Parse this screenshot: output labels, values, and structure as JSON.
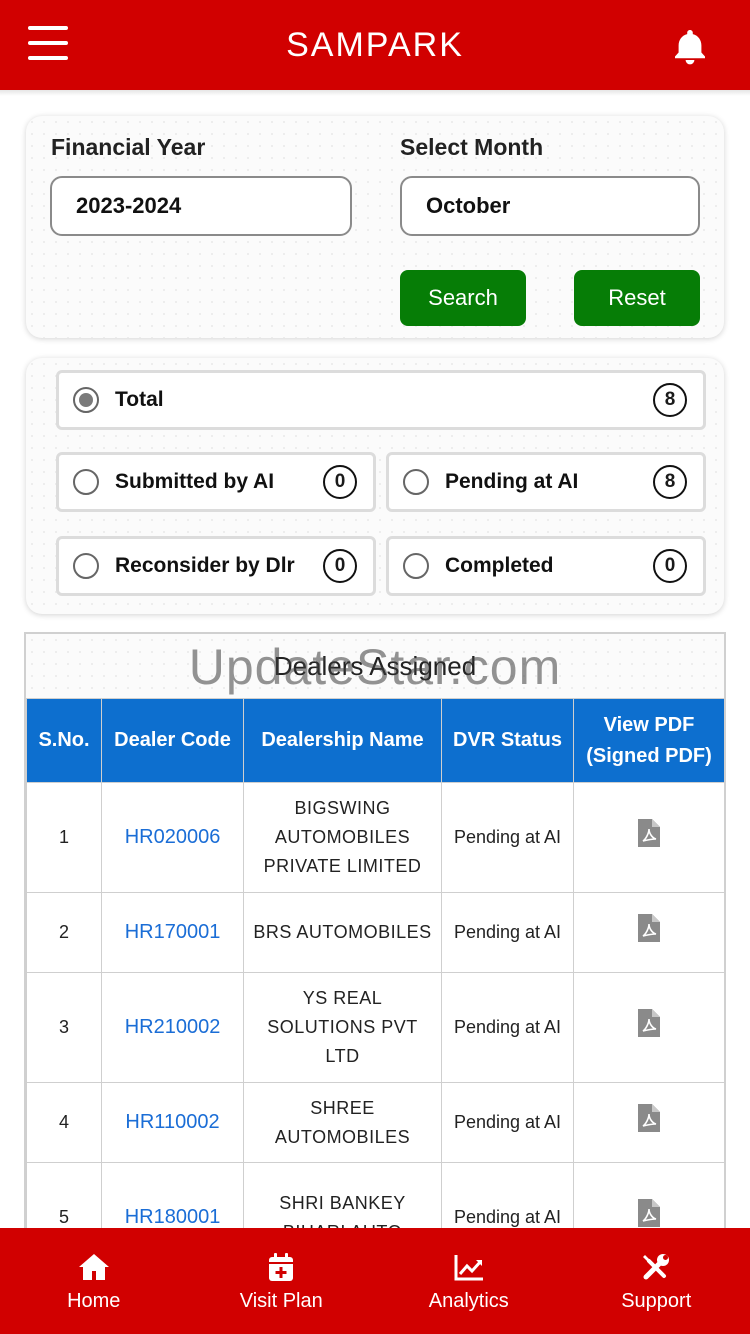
{
  "header": {
    "title": "SAMPARK"
  },
  "filters": {
    "financial_year_label": "Financial Year",
    "financial_year_value": "2023-2024",
    "month_label": "Select Month",
    "month_value": "October",
    "search_label": "Search",
    "reset_label": "Reset"
  },
  "status": {
    "total": {
      "label": "Total",
      "count": "8",
      "selected": true
    },
    "submitted": {
      "label": "Submitted by AI",
      "count": "0"
    },
    "pending": {
      "label": "Pending at AI",
      "count": "8"
    },
    "reconsider": {
      "label": "Reconsider by Dlr",
      "count": "0"
    },
    "completed": {
      "label": "Completed",
      "count": "0"
    }
  },
  "table": {
    "title": "Dealers Assigned",
    "watermark": "UpdateStar.com",
    "headers": {
      "sno": "S.No.",
      "code": "Dealer Code",
      "name": "Dealership Name",
      "status": "DVR Status",
      "pdf_line1": "View PDF",
      "pdf_line2": "(Signed PDF)"
    },
    "rows": [
      {
        "sno": "1",
        "code": "HR020006",
        "name": "BIGSWING AUTOMOBILES PRIVATE LIMITED",
        "status": "Pending at AI"
      },
      {
        "sno": "2",
        "code": "HR170001",
        "name": "BRS AUTOMOBILES",
        "status": "Pending at AI"
      },
      {
        "sno": "3",
        "code": "HR210002",
        "name": "YS REAL SOLUTIONS PVT LTD",
        "status": "Pending at AI"
      },
      {
        "sno": "4",
        "code": "HR110002",
        "name": "SHREE AUTOMOBILES",
        "status": "Pending at AI"
      },
      {
        "sno": "5",
        "code": "HR180001",
        "name": "SHRI BANKEY BIHARI AUTO",
        "status": "Pending at AI"
      }
    ]
  },
  "nav": {
    "home": "Home",
    "visit_plan": "Visit Plan",
    "analytics": "Analytics",
    "support": "Support"
  },
  "colors": {
    "brand_red": "#d10000",
    "button_green": "#067d06",
    "table_header_blue": "#0d6fcf",
    "link_blue": "#1a6dd6"
  }
}
